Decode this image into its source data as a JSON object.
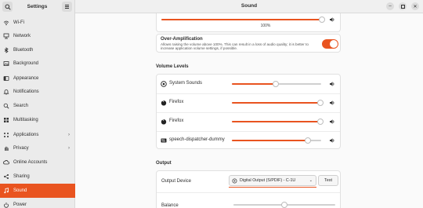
{
  "sidebar": {
    "title": "Settings",
    "items": [
      {
        "label": "Wi-Fi",
        "icon": "wifi-icon"
      },
      {
        "label": "Network",
        "icon": "network-icon"
      },
      {
        "label": "Bluetooth",
        "icon": "bluetooth-icon"
      },
      {
        "label": "Background",
        "icon": "background-icon"
      },
      {
        "label": "Appearance",
        "icon": "appearance-icon"
      },
      {
        "label": "Notifications",
        "icon": "bell-icon"
      },
      {
        "label": "Search",
        "icon": "search-icon"
      },
      {
        "label": "Multitasking",
        "icon": "multitasking-icon"
      },
      {
        "label": "Applications",
        "icon": "apps-icon",
        "chevron": true
      },
      {
        "label": "Privacy",
        "icon": "hand-icon",
        "chevron": true
      },
      {
        "label": "Online Accounts",
        "icon": "cloud-icon"
      },
      {
        "label": "Sharing",
        "icon": "share-icon"
      },
      {
        "label": "Sound",
        "icon": "music-note-icon",
        "active": true
      },
      {
        "label": "Power",
        "icon": "power-icon"
      }
    ]
  },
  "header": {
    "title": "Sound"
  },
  "colors": {
    "accent": "#e95420",
    "sidebar_bg": "#ebebeb",
    "card_bg": "#ffffff"
  },
  "output_volume": {
    "value_label": "100%",
    "level": 1.0
  },
  "over_amplification": {
    "title": "Over-Amplification",
    "description": "Allows raising the volume above 100%. This can result in a loss of audio quality; it is better to increase application volume settings, if possible.",
    "enabled": true
  },
  "volume_levels": {
    "heading": "Volume Levels",
    "rows": [
      {
        "label": "System Sounds",
        "icon": "system-sounds-icon",
        "level": 0.49
      },
      {
        "label": "Firefox",
        "icon": "firefox-icon",
        "level": 0.99
      },
      {
        "label": "Firefox",
        "icon": "firefox-icon",
        "level": 0.99
      },
      {
        "label": "speech-dispatcher-dummy",
        "icon": "speech-dispatcher-icon",
        "level": 0.85
      }
    ]
  },
  "output": {
    "heading": "Output",
    "device_label": "Output Device",
    "device_value": "Digital Output (S/PDIF) - C-1U",
    "test_label": "Test",
    "balance_label": "Balance",
    "balance": 0.5
  }
}
